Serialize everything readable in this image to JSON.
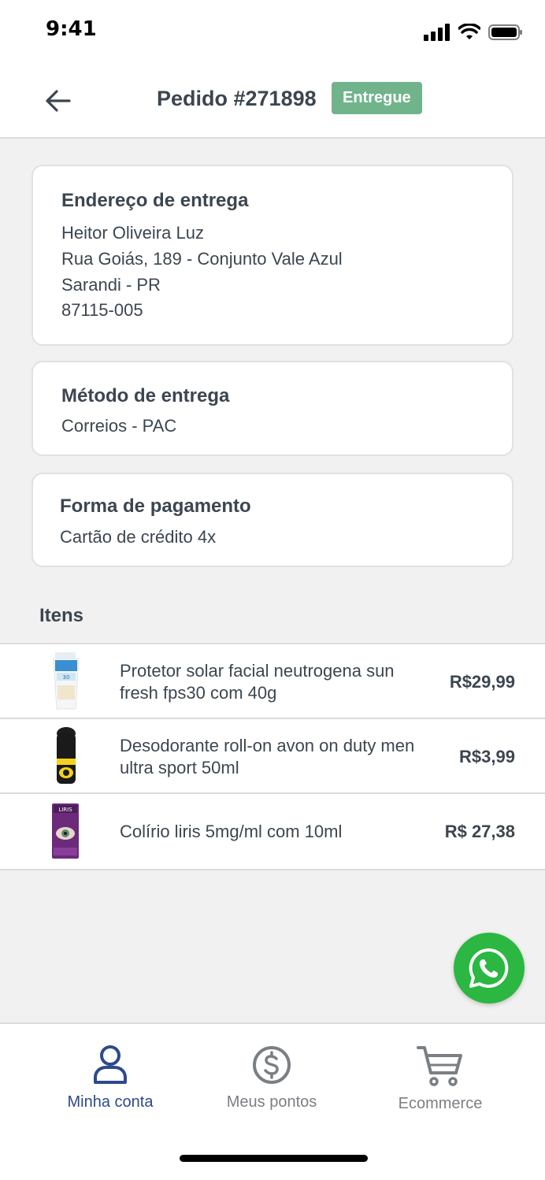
{
  "status_bar": {
    "time": "9:41"
  },
  "header": {
    "title": "Pedido #271898",
    "status": "Entregue"
  },
  "delivery_address": {
    "title": "Endereço de entrega",
    "lines": [
      "Heitor Oliveira Luz",
      "Rua Goiás, 189 - Conjunto Vale Azul",
      "Sarandi - PR",
      "87115-005"
    ]
  },
  "delivery_method": {
    "title": "Método de entrega",
    "value": "Correios - PAC"
  },
  "payment": {
    "title": "Forma de pagamento",
    "value": "Cartão de crédito 4x"
  },
  "items": {
    "heading": "Itens",
    "list": [
      {
        "name": "Protetor solar facial neutrogena sun fresh fps30 com 40g",
        "price": "R$29,99"
      },
      {
        "name": "Desodorante roll-on avon on duty men ultra sport 50ml",
        "price": "R$3,99"
      },
      {
        "name": "Colírio liris 5mg/ml com 10ml",
        "price": "R$ 27,38"
      }
    ]
  },
  "bottom_nav": [
    {
      "label": "Minha conta",
      "icon": "user-icon",
      "active": true
    },
    {
      "label": "Meus pontos",
      "icon": "dollar-coin-icon",
      "active": false
    },
    {
      "label": "Ecommerce",
      "icon": "cart-icon",
      "active": false
    }
  ],
  "colors": {
    "badge": "#71b48b",
    "active_nav": "#2c4a8c",
    "inactive_nav": "#7b7f84",
    "whatsapp": "#2bb741"
  }
}
